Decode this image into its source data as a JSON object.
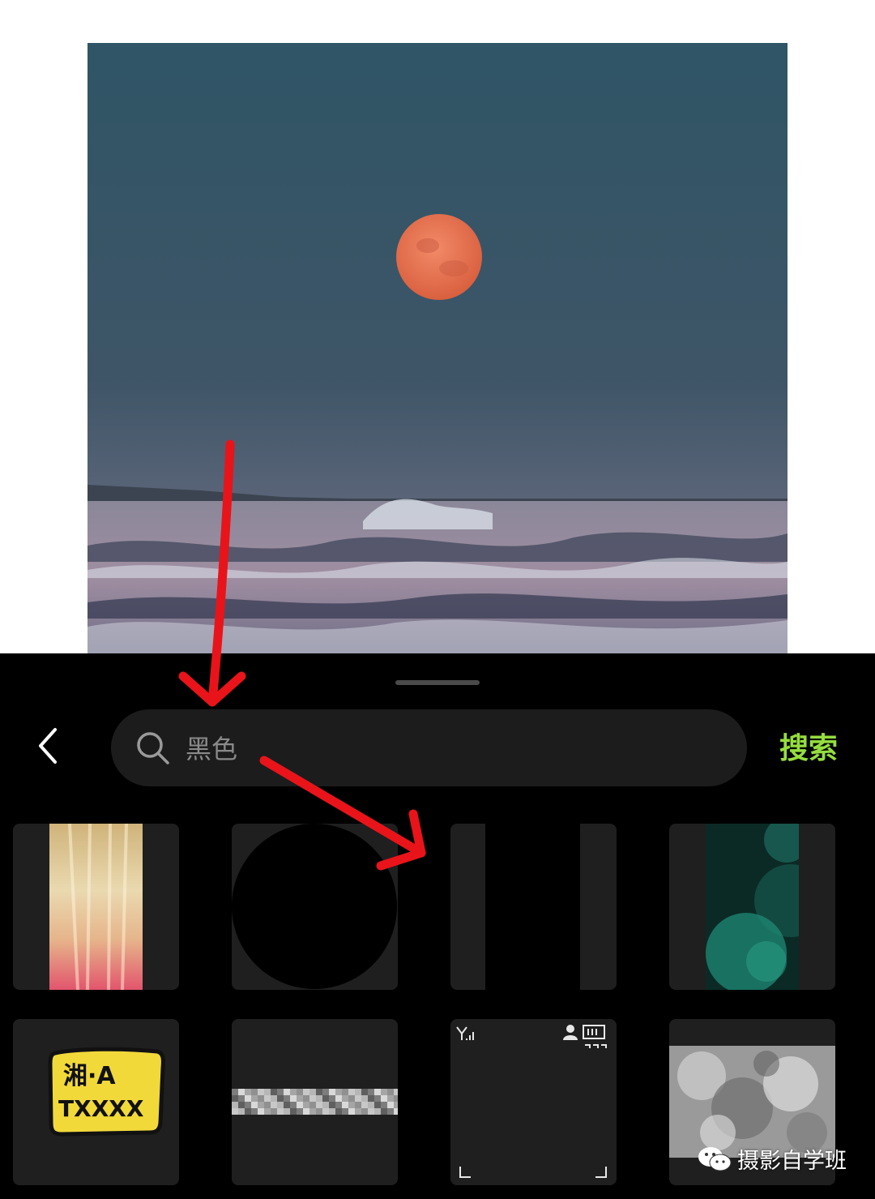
{
  "search": {
    "placeholder": "黑色",
    "button_label": "搜索"
  },
  "stickers": [
    {
      "name": "golden-gradient-sticker",
      "text": ""
    },
    {
      "name": "black-circle-sticker",
      "text": ""
    },
    {
      "name": "black-bars-sticker",
      "text": ""
    },
    {
      "name": "teal-bokeh-sticker",
      "text": ""
    },
    {
      "name": "license-plate-sticker",
      "text_line1": "湘·A",
      "text_line2": "TXXXX"
    },
    {
      "name": "mosaic-bar-sticker",
      "text": ""
    },
    {
      "name": "phone-frame-sticker",
      "text": ""
    },
    {
      "name": "gray-texture-sticker",
      "text": ""
    }
  ],
  "watermark": {
    "text": "摄影自学班"
  },
  "colors": {
    "accent": "#95de3f",
    "panel": "#000000",
    "tile": "#1f1f1f",
    "arrow": "#e8141a"
  }
}
